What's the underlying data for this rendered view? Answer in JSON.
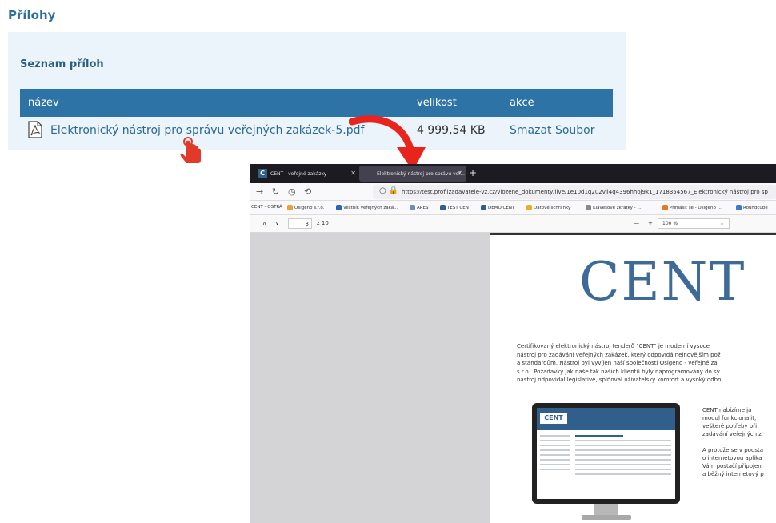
{
  "section": {
    "title": "Přílohy"
  },
  "attachments": {
    "title": "Seznam příloh",
    "columns": {
      "name": "název",
      "size": "velikost",
      "action": "akce"
    },
    "rows": [
      {
        "name": "Elektronický nástroj pro správu veřejných zakázek-5.pdf",
        "size": "4 999,54 KB",
        "action": "Smazat Soubor"
      }
    ]
  },
  "browser": {
    "tabs": [
      {
        "label": "CENT - veřejné zakázky"
      },
      {
        "label": "Elektronický nástroj pro správu veř..."
      }
    ],
    "url": "https://test.profilzadavatele-vz.cz/vlozene_dokumenty/live/1e10d1q2u2vji4q4396hhoj9k1_1718354567_Elektronický nástroj pro sp",
    "bookmarks": [
      "CENT - OSTRÁ",
      "Osigeno s.r.o.",
      "Věstník veřejných zaká...",
      "ARES",
      "TEST CENT",
      "DEMO CENT",
      "Datové schránky",
      "Klávesové zkratky - ...",
      "Přihlásit se - Osigeno ...",
      "Roundcube"
    ],
    "pdf": {
      "page_current": "3",
      "page_total": "z 10",
      "zoom": "100 %",
      "logo": "CENT",
      "intro_lines": [
        "Certifikovaný elektronický nástroj tenderů \"CENT\" je moderní vysoce",
        "nástroj pro zadávání veřejných zakázek, který odpovídá nejnovějším pož",
        "a standardům. Nástroj byl vyvíjen naší společností Osigeno - veřejné za",
        "s.r.o.. Požadavky jak naše tak našich klientů byly naprogramovány do sy",
        "nástroj odpovídal legislativě, splňoval uživatelský komfort a vysoký odbo"
      ],
      "side_block1": [
        "CENT nabízíme ja",
        "modul funkcionalit,",
        "veškeré potřeby při",
        "zadávání veřejných z"
      ],
      "side_block2": [
        "A protože se v podsta",
        "o internetovou aplika",
        "Vám postačí připojen",
        "a běžný internetový p"
      ],
      "monitor_logo": "CENT"
    }
  }
}
